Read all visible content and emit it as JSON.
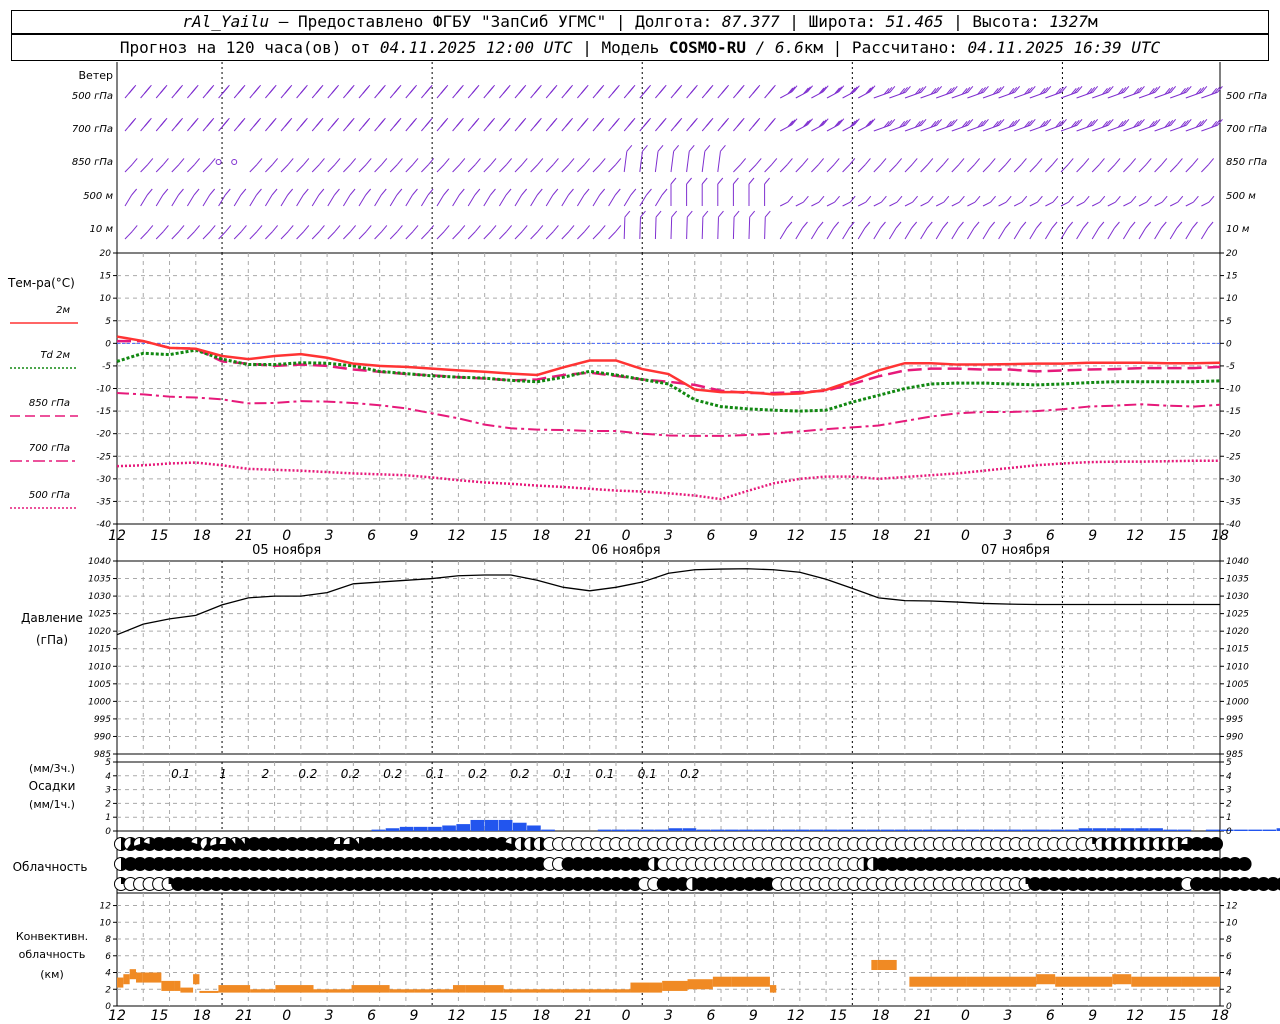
{
  "header": {
    "station": "rAl_Yailu",
    "dash": " — ",
    "provided": "Предоставлено ФГБУ \"ЗапСиб УГМС\" | ",
    "lon_label": "Долгота: ",
    "lon": "87.377",
    "lat_label": " | Широта: ",
    "lat": "51.465",
    "alt_label": " | Высота: ",
    "alt": "1327",
    "alt_unit": "м",
    "forecast_label": "Прогноз на 120 часа(ов) от ",
    "forecast_time": "04.11.2025 12:00 UTC",
    "model_label": " | Модель ",
    "model": "COSMO-RU",
    "model_res_sep": " / ",
    "model_res": "6.6",
    "model_res_unit": "км",
    "calc_label": " | Рассчитано: ",
    "calc_time": "04.11.2025 16:39 UTC"
  },
  "hour_labels": [
    "12",
    "15",
    "18",
    "21",
    "0",
    "3",
    "6",
    "9",
    "12",
    "15",
    "18",
    "21",
    "0",
    "3",
    "6",
    "9",
    "12",
    "15",
    "18",
    "21",
    "0",
    "3",
    "6",
    "9",
    "12",
    "15",
    "18"
  ],
  "date_labels": [
    "05 ноября",
    "06 ноября",
    "07 ноября"
  ],
  "wind_panel": {
    "title": "Ветер",
    "levels": [
      "500 гПа",
      "700 гПа",
      "850 гПа",
      "500 м",
      "10  м"
    ],
    "color": "#7f2fd0"
  },
  "temp_panel": {
    "title": "Тем-ра(°С)",
    "ylim": [
      -40,
      20
    ],
    "ticks": [
      "20",
      "15",
      "10",
      "5",
      "0",
      "-5",
      "-10",
      "-15",
      "-20",
      "-25",
      "-30",
      "-35",
      "-40"
    ],
    "legend": [
      {
        "label": "2м",
        "color": "#ff3333",
        "style": "solid"
      },
      {
        "label": "Td  2м",
        "color": "#118811",
        "style": "dotted"
      },
      {
        "label": "850 гПа",
        "color": "#e6197a",
        "style": "dashed"
      },
      {
        "label": "700 гПа",
        "color": "#e6197a",
        "style": "dashdot"
      },
      {
        "label": "500 гПа",
        "color": "#e6197a",
        "style": "dotted"
      }
    ]
  },
  "pressure_panel": {
    "title": "Давление",
    "unit": "(гПа)",
    "ylim": [
      985,
      1040
    ],
    "ticks": [
      "1040",
      "1035",
      "1030",
      "1025",
      "1020",
      "1015",
      "1010",
      "1005",
      "1000",
      "995",
      "990",
      "985"
    ]
  },
  "precip_panel": {
    "unit_top": "(мм/3ч.)",
    "title": "Осадки",
    "unit_bottom": "(мм/1ч.)",
    "ticks": [
      "5",
      "4",
      "3",
      "2",
      "1",
      "0"
    ],
    "totals": [
      "0.1",
      "1",
      "2",
      "0.2",
      "0.2",
      "0.2",
      "0.1",
      "0.2",
      "0.2",
      "0.1",
      "0.1",
      "0.1",
      "0.2"
    ],
    "color": "#2255ee"
  },
  "cloud_panel": {
    "title": "Облачность"
  },
  "conv_panel": {
    "title1": "Конвективн.",
    "title2": "облачность",
    "unit": "(км)",
    "ticks": [
      "12",
      "10",
      "8",
      "6",
      "4",
      "2",
      "0"
    ],
    "color": "#f08a24"
  },
  "chart_data": {
    "type": "meteogram",
    "x_hours_from_start": [
      0,
      3,
      6,
      9,
      12,
      15,
      18,
      21,
      24,
      27,
      30,
      33,
      36,
      39,
      42,
      45,
      48,
      51,
      54,
      57,
      60,
      63,
      66,
      69,
      72,
      75,
      78,
      81,
      84,
      87,
      90,
      93,
      96,
      99,
      102,
      105,
      108,
      111,
      114,
      117,
      120,
      123,
      126
    ],
    "temperature": {
      "t2m": [
        1.5,
        0.5,
        -1,
        -1.2,
        -2.8,
        -3.5,
        -2.8,
        -2.4,
        -3.2,
        -4.5,
        -5,
        -5.2,
        -5.6,
        -6,
        -6.3,
        -6.7,
        -7,
        -5.3,
        -3.8,
        -3.8,
        -5.7,
        -6.8,
        -10.2,
        -10.8,
        -10.8,
        -11.3,
        -11.1,
        -10.3,
        -8.3,
        -6,
        -4.4,
        -4.4,
        -4.7,
        -4.7,
        -4.6,
        -4.5,
        -4.5,
        -4.3,
        -4.3,
        -4.3,
        -4.4,
        -4.4,
        -4.3
      ],
      "td2m": [
        -4,
        -2.2,
        -2.5,
        -1.5,
        -3.5,
        -4.7,
        -4.7,
        -4.3,
        -4.4,
        -5,
        -6.2,
        -6.7,
        -7.2,
        -7.5,
        -7.7,
        -8.2,
        -8.5,
        -7.5,
        -6.2,
        -7,
        -8,
        -9,
        -12.5,
        -14,
        -14.5,
        -14.8,
        -15,
        -14.8,
        -13,
        -11.5,
        -10,
        -9,
        -8.8,
        -8.8,
        -9,
        -9.2,
        -9,
        -8.7,
        -8.5,
        -8.5,
        -8.5,
        -8.5,
        -8.3
      ],
      "t850": [
        0.5,
        0.5,
        -1,
        -1.2,
        -4,
        -4.5,
        -5,
        -4.7,
        -5,
        -5.8,
        -6.3,
        -6.8,
        -7.1,
        -7.5,
        -7.8,
        -8.2,
        -8,
        -7,
        -6.5,
        -7.2,
        -8,
        -8.5,
        -9.2,
        -10.5,
        -11,
        -11,
        -10.8,
        -10.5,
        -9,
        -7.3,
        -6,
        -5.6,
        -5.6,
        -5.8,
        -5.8,
        -6.2,
        -6,
        -5.8,
        -5.7,
        -5.5,
        -5.5,
        -5.5,
        -5.2
      ],
      "t700": [
        -11,
        -11.3,
        -11.8,
        -12,
        -12.4,
        -13.3,
        -13.2,
        -12.8,
        -12.9,
        -13.2,
        -13.7,
        -14.4,
        -15.5,
        -16.6,
        -18,
        -18.8,
        -19.1,
        -19.2,
        -19.4,
        -19.4,
        -20,
        -20.4,
        -20.5,
        -20.5,
        -20.3,
        -20,
        -19.5,
        -19,
        -18.6,
        -18.2,
        -17.2,
        -16.2,
        -15.5,
        -15.2,
        -15.2,
        -15,
        -14.6,
        -14,
        -13.8,
        -13.5,
        -13.8,
        -14,
        -13.6
      ],
      "t500": [
        -27.2,
        -27,
        -26.6,
        -26.4,
        -27,
        -27.8,
        -28,
        -28.2,
        -28.5,
        -28.8,
        -29,
        -29.2,
        -29.7,
        -30.3,
        -30.8,
        -31.1,
        -31.5,
        -31.8,
        -32.2,
        -32.6,
        -32.8,
        -33.2,
        -33.7,
        -34.5,
        -32.7,
        -31,
        -30,
        -29.5,
        -29.5,
        -30,
        -29.6,
        -29.2,
        -28.8,
        -28.2,
        -27.6,
        -27,
        -26.6,
        -26.3,
        -26.2,
        -26.2,
        -26.1,
        -26,
        -26
      ]
    },
    "pressure": [
      1019,
      1022,
      1023.5,
      1024.5,
      1027.5,
      1029.5,
      1030,
      1030,
      1031,
      1033.5,
      1034,
      1034.5,
      1035,
      1035.8,
      1036,
      1036,
      1034.5,
      1032.5,
      1031.5,
      1032.5,
      1034,
      1036.5,
      1037.5,
      1037.7,
      1037.8,
      1037.5,
      1036.8,
      1034.8,
      1032.2,
      1029.5,
      1028.7,
      1028.6,
      1028.3,
      1027.9,
      1027.7,
      1027.6,
      1027.6,
      1027.6,
      1027.6,
      1027.6,
      1027.6,
      1027.6,
      1027.6
    ],
    "precip_hourly": [
      0,
      0,
      0,
      0,
      0,
      0,
      0,
      0,
      0,
      0,
      0,
      0,
      0,
      0,
      0,
      0,
      0,
      0,
      0.1,
      0.2,
      0.3,
      0.3,
      0.3,
      0.4,
      0.5,
      0.8,
      0.8,
      0.8,
      0.6,
      0.4,
      0.1,
      0,
      0,
      0,
      0.1,
      0.1,
      0.1,
      0.1,
      0.1,
      0.2,
      0.2,
      0.1,
      0.1,
      0.1,
      0.1,
      0.1,
      0.1,
      0.1,
      0.1,
      0.1,
      0.1,
      0.1,
      0.1,
      0.1,
      0.1,
      0.1,
      0.1,
      0.1,
      0.1,
      0.1,
      0.1,
      0.1,
      0.1,
      0.1,
      0.1,
      0.1,
      0.1,
      0.1,
      0.2,
      0.2,
      0.2,
      0.2,
      0.2,
      0.2,
      0.1,
      0.1,
      0,
      0.1,
      0.1,
      0.1,
      0.1,
      0.1,
      0.2,
      0.2,
      0.3,
      0,
      0,
      0,
      0,
      0,
      0,
      0,
      0,
      0,
      0,
      0,
      0,
      0,
      0,
      0,
      0,
      0,
      0,
      0,
      0,
      0.05,
      0,
      0,
      0,
      0,
      0,
      0,
      0,
      0,
      0,
      0,
      0,
      0,
      0,
      0,
      0,
      0,
      0,
      0,
      0,
      0,
      0,
      0,
      0,
      0,
      0,
      0,
      0,
      0,
      0,
      0,
      0,
      0,
      0,
      0,
      0,
      0,
      0
    ],
    "cloud_high": [
      0.5,
      0.6,
      0.7,
      0.8,
      1,
      1,
      1,
      1,
      0.8,
      0.6,
      0.7,
      0.75,
      0.9,
      0.9,
      1,
      1,
      1,
      1,
      1,
      1,
      1,
      1,
      1,
      0.75,
      0.75,
      0.9,
      1,
      1,
      1,
      1,
      1,
      1,
      1,
      1,
      1,
      1,
      1,
      1,
      1,
      1,
      1,
      0.8,
      0.5,
      0.5,
      0.5,
      0,
      0,
      0,
      0,
      0,
      0,
      0,
      0,
      0,
      0,
      0,
      0,
      0,
      0,
      0,
      0,
      0,
      0,
      0,
      0,
      0,
      0,
      0,
      0,
      0,
      0,
      0,
      0,
      0,
      0,
      0,
      0,
      0,
      0,
      0,
      0,
      0,
      0,
      0,
      0,
      0,
      0,
      0,
      0,
      0,
      0,
      0,
      0,
      0,
      0,
      0,
      0,
      0,
      0,
      0,
      0,
      0,
      0.25,
      0.5,
      0.5,
      0.5,
      0.5,
      0.5,
      0.5,
      0.5,
      0.5,
      0.5,
      0.75,
      1,
      1,
      1
    ],
    "cloud_mid": [
      0.5,
      1,
      1,
      1,
      1,
      1,
      1,
      1,
      1,
      1,
      1,
      1,
      1,
      1,
      1,
      1,
      1,
      1,
      1,
      1,
      1,
      1,
      1,
      1,
      1,
      1,
      1,
      1,
      1,
      1,
      1,
      1,
      1,
      1,
      1,
      1,
      1,
      1,
      1,
      1,
      1,
      1,
      1,
      1,
      1,
      0,
      0,
      1,
      1,
      1,
      1,
      1,
      1,
      1,
      1,
      1,
      0.5,
      0,
      0,
      0,
      0,
      0,
      0,
      0,
      0,
      0,
      0,
      0,
      0,
      0,
      0,
      0,
      0,
      0,
      0,
      0,
      0,
      0,
      0.5,
      0.5,
      1,
      1,
      1,
      1,
      1,
      1,
      1,
      1,
      1,
      1,
      1,
      1,
      1,
      1,
      1,
      1,
      1,
      1,
      1,
      1,
      1,
      1,
      1,
      1,
      1,
      1,
      1,
      1,
      1,
      1,
      1,
      1,
      1,
      1,
      1,
      1,
      1,
      1,
      1
    ],
    "cloud_low": [
      0.25,
      0,
      0,
      0,
      0,
      0.25,
      1,
      1,
      1,
      1,
      1,
      1,
      1,
      1,
      1,
      1,
      1,
      1,
      1,
      1,
      1,
      1,
      1,
      1,
      1,
      1,
      1,
      1,
      1,
      1,
      1,
      1,
      1,
      1,
      1,
      1,
      1,
      1,
      1,
      1,
      1,
      1,
      1,
      1,
      1,
      1,
      1,
      1,
      1,
      1,
      1,
      1,
      1,
      1,
      1,
      0,
      0,
      1,
      1,
      1,
      0.5,
      1,
      1,
      1,
      1,
      1,
      1,
      1,
      1,
      0,
      0,
      0,
      0,
      0,
      0,
      0,
      0,
      0,
      0,
      0,
      0,
      0,
      0,
      0,
      0,
      0,
      0,
      0,
      0,
      0,
      0,
      0,
      0,
      0,
      0,
      0.25,
      1,
      1,
      1,
      1,
      1,
      1,
      1,
      1,
      1,
      1,
      1,
      1,
      1,
      1,
      1,
      1,
      0,
      1,
      1,
      1,
      1,
      1,
      1,
      1,
      1,
      1,
      1,
      1,
      1,
      1,
      1,
      1,
      1,
      1
    ],
    "conv_segments": [
      [
        0,
        1,
        3.4
      ],
      [
        1,
        2,
        3.8
      ],
      [
        2,
        3,
        4.4
      ],
      [
        3,
        4,
        4
      ],
      [
        4,
        7,
        4
      ],
      [
        7,
        9,
        3
      ],
      [
        9,
        10,
        3
      ],
      [
        10,
        12,
        2.2
      ],
      [
        12,
        13,
        3.8
      ],
      [
        13,
        16,
        1.8
      ],
      [
        16,
        21,
        2.5
      ],
      [
        21,
        25,
        2
      ],
      [
        25,
        31,
        2.5
      ],
      [
        31,
        37,
        2
      ],
      [
        37,
        43,
        2.5
      ],
      [
        43,
        47,
        2
      ],
      [
        47,
        53,
        2
      ],
      [
        53,
        55,
        2.5
      ],
      [
        55,
        61,
        2.5
      ],
      [
        61,
        70,
        2
      ],
      [
        70,
        81,
        2
      ],
      [
        81,
        84,
        2.8
      ],
      [
        84,
        86,
        2.8
      ],
      [
        86,
        90,
        3
      ],
      [
        90,
        94,
        3.2
      ],
      [
        94,
        97,
        3.5
      ],
      [
        97,
        103,
        3.5
      ],
      [
        103,
        104,
        2.5
      ],
      [
        119,
        120,
        5.5
      ],
      [
        120,
        123,
        5.5
      ],
      [
        125,
        134,
        3.5
      ],
      [
        134,
        145,
        3.5
      ],
      [
        145,
        148,
        3.8
      ],
      [
        148,
        157,
        3.5
      ],
      [
        157,
        160,
        3.8
      ],
      [
        160,
        168,
        3.5
      ],
      [
        168,
        174,
        3.5
      ]
    ]
  }
}
